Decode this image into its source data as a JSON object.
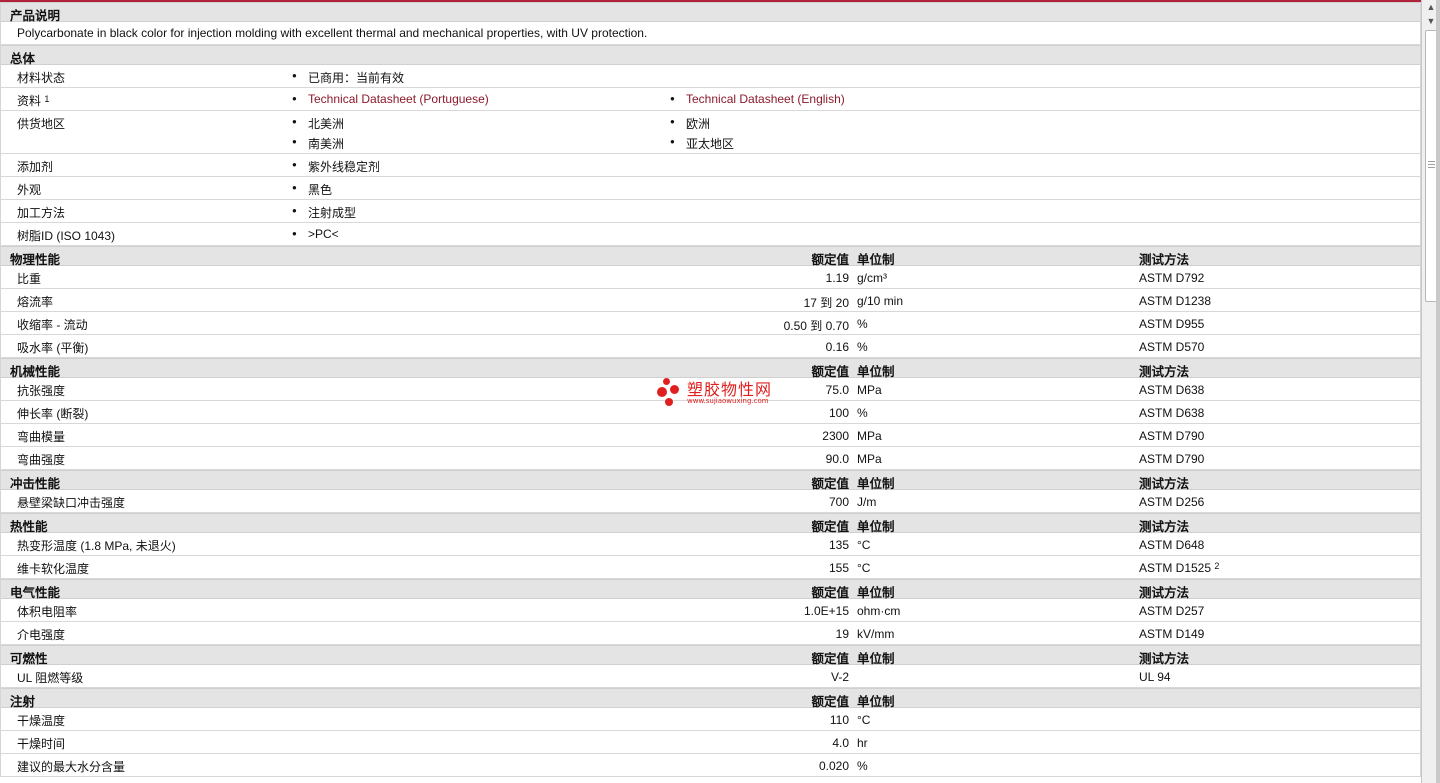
{
  "product": {
    "section_title": "产品说明",
    "description": "Polycarbonate in black color for injection molding with excellent thermal and mechanical properties, with UV protection."
  },
  "general": {
    "section_title": "总体",
    "material_status_label": "材料状态",
    "material_status_value": "已商用：当前有效",
    "docs_label": "资料",
    "docs_sup": "1",
    "doc1": "Technical Datasheet (Portuguese)",
    "doc2": "Technical Datasheet (English)",
    "region_label": "供货地区",
    "region1": "北美洲",
    "region2": "欧洲",
    "region3": "南美洲",
    "region4": "亚太地区",
    "additive_label": "添加剂",
    "additive_value": "紫外线稳定剂",
    "appearance_label": "外观",
    "appearance_value": "黑色",
    "process_label": "加工方法",
    "process_value": "注射成型",
    "resin_label": "树脂ID (ISO 1043)",
    "resin_value": ">PC<"
  },
  "headers": {
    "nominal": "额定值",
    "unit": "单位制",
    "test": "测试方法"
  },
  "physical": {
    "section_title": "物理性能",
    "rows": [
      {
        "label": "比重",
        "value": "1.19",
        "unit": "g/cm³",
        "test": "ASTM D792"
      },
      {
        "label": "熔流率",
        "value": "17 到  20",
        "unit": "g/10 min",
        "test": "ASTM D1238"
      },
      {
        "label": "收缩率  - 流动",
        "value": "0.50 到  0.70",
        "unit": "%",
        "test": "ASTM D955"
      },
      {
        "label": "吸水率  (平衡)",
        "value": "0.16",
        "unit": "%",
        "test": "ASTM D570"
      }
    ]
  },
  "mechanical": {
    "section_title": "机械性能",
    "rows": [
      {
        "label": "抗张强度",
        "value": "75.0",
        "unit": "MPa",
        "test": "ASTM D638"
      },
      {
        "label": "伸长率  (断裂)",
        "value": "100",
        "unit": "%",
        "test": "ASTM D638"
      },
      {
        "label": "弯曲模量",
        "value": "2300",
        "unit": "MPa",
        "test": "ASTM D790"
      },
      {
        "label": "弯曲强度",
        "value": "90.0",
        "unit": "MPa",
        "test": "ASTM D790"
      }
    ]
  },
  "impact": {
    "section_title": "冲击性能",
    "rows": [
      {
        "label": "悬壁梁缺口冲击强度",
        "value": "700",
        "unit": "J/m",
        "test": "ASTM D256"
      }
    ]
  },
  "thermal": {
    "section_title": "热性能",
    "rows": [
      {
        "label": "热变形温度  (1.8 MPa, 未退火)",
        "value": "135",
        "unit": "°C",
        "test": "ASTM D648"
      },
      {
        "label": "维卡软化温度",
        "value": "155",
        "unit": "°C",
        "test": "ASTM D1525",
        "sup": "2"
      }
    ]
  },
  "electrical": {
    "section_title": "电气性能",
    "rows": [
      {
        "label": "体积电阻率",
        "value": "1.0E+15",
        "unit": "ohm·cm",
        "test": "ASTM D257"
      },
      {
        "label": "介电强度",
        "value": "19",
        "unit": "kV/mm",
        "test": "ASTM D149"
      }
    ]
  },
  "flammability": {
    "section_title": "可燃性",
    "rows": [
      {
        "label": "UL 阻燃等级",
        "value": "V-2",
        "unit": "",
        "test": "UL 94"
      }
    ]
  },
  "injection": {
    "section_title": "注射",
    "rows": [
      {
        "label": "干燥温度",
        "value": "110",
        "unit": "°C"
      },
      {
        "label": "干燥时间",
        "value": "4.0",
        "unit": "hr"
      },
      {
        "label": "建议的最大水分含量",
        "value": "0.020",
        "unit": "%"
      }
    ]
  },
  "watermark": {
    "text": "塑胶物性网",
    "url": "www.sujiaowuxing.com"
  },
  "colors": {
    "accent": "#b0233a",
    "link": "#8b1a2b",
    "section_bg": "#e4e4e4",
    "watermark": "#e02020"
  }
}
